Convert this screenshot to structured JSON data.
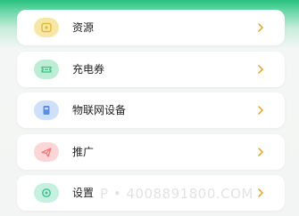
{
  "menu": {
    "items": [
      {
        "label": "资源",
        "icon": "resource-icon",
        "icon_bg": "#f7e7a6",
        "icon_fg": "#e0b93a"
      },
      {
        "label": "充电券",
        "icon": "ticket-icon",
        "icon_bg": "#bdeed5",
        "icon_fg": "#3fbf83"
      },
      {
        "label": "物联网设备",
        "icon": "device-icon",
        "icon_bg": "#cfe0fb",
        "icon_fg": "#5b8fe0"
      },
      {
        "label": "推广",
        "icon": "send-icon",
        "icon_bg": "#fcd6d6",
        "icon_fg": "#ef7a7a"
      },
      {
        "label": "设置",
        "icon": "settings-icon",
        "icon_bg": "#c6f0e0",
        "icon_fg": "#3cbf92"
      }
    ],
    "chevron_color": "#e0a12a"
  },
  "watermark": {
    "text": "P • 4008891800.COM"
  }
}
